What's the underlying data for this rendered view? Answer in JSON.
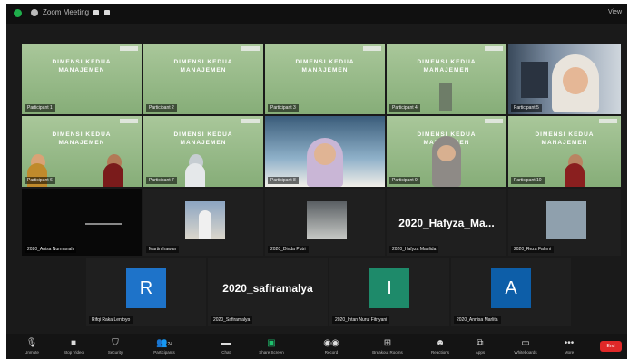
{
  "meeting": {
    "title": "Zoom Meeting",
    "view_label": "View"
  },
  "slide": {
    "line1": "DIMENSI KEDUA",
    "line2": "MANAJEMEN"
  },
  "tiles": [
    {
      "name": "Participant 1"
    },
    {
      "name": "Participant 2"
    },
    {
      "name": "Participant 3"
    },
    {
      "name": "Participant 4"
    },
    {
      "name": "Participant 5"
    },
    {
      "name": "Participant 6"
    },
    {
      "name": "Participant 7"
    },
    {
      "name": "Participant 8"
    },
    {
      "name": "Participant 9"
    },
    {
      "name": "Participant 10"
    },
    {
      "name": "2020_Anisa Nurmanah"
    },
    {
      "name": "Martin Irawan"
    },
    {
      "name": "2020_Dinda Putri"
    },
    {
      "name": "2020_Hafyza Maulida",
      "display": "2020_Hafyza_Ma..."
    },
    {
      "name": "2020_Reza Fahmi"
    },
    {
      "name": "Rifqi Raka Lentoyo",
      "initial": "R"
    },
    {
      "name": "2020_Safiramalya",
      "display": "2020_safiramalya"
    },
    {
      "name": "2020_Intan Nurul Fitriyani",
      "initial": "I"
    },
    {
      "name": "2020_Annisa Marlita",
      "initial": "A"
    }
  ],
  "toolbar": {
    "unmute": "Unmute",
    "stop_video": "Stop Video",
    "security": "Security",
    "participants": "Participants",
    "participants_count": "24",
    "chat": "Chat",
    "share_screen": "Share Screen",
    "record": "Record",
    "breakout": "Breakout Rooms",
    "reactions": "Reactions",
    "apps": "Apps",
    "whiteboards": "Whiteboards",
    "more": "More",
    "end": "End"
  },
  "colors": {
    "avatar_blue": "#1e73c9",
    "avatar_teal": "#1e8a6a",
    "avatar_navy": "#0d5ea8",
    "active_speaker": "#7ed957",
    "end": "#e02828"
  }
}
